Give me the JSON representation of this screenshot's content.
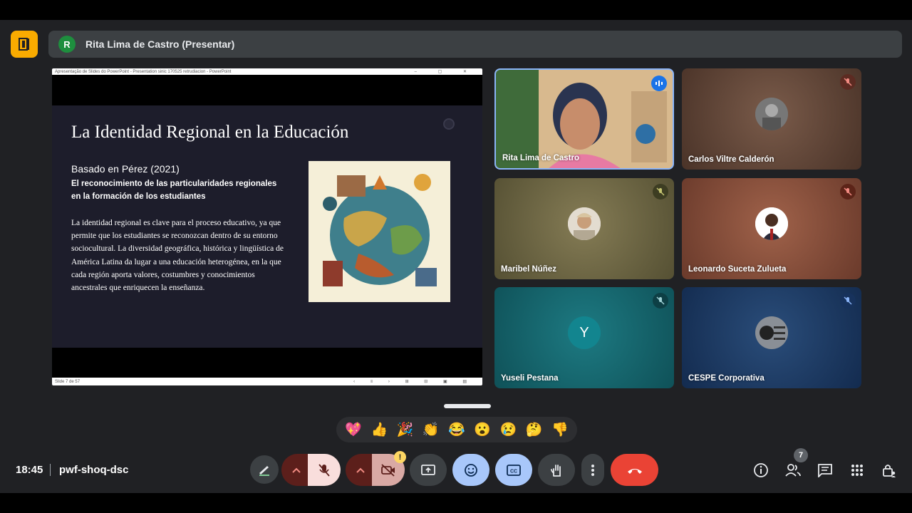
{
  "presenter_bar": {
    "avatar_letter": "R",
    "label": "Rita Lima de Castro (Presentar)"
  },
  "presentation": {
    "window_title": "Apresentação de Slides do PowerPoint  -  Presentation sinic 170525 retrudiacion  -  PowerPoint",
    "status_left": "Slide 7 de 57",
    "slide": {
      "title": "La Identidad Regional en la Educación",
      "subtitle": "Basado en Pérez (2021)",
      "bold_text": "El reconocimiento de las particularidades regionales en la formación de los estudiantes",
      "body": "La identidad regional es clave para el proceso educativo, ya que permite que los estudiantes se reconozcan dentro de su entorno sociocultural. La diversidad geográfica, histórica y lingüística de América Latina da lugar a una educación heterogénea, en la que cada región aporta valores, costumbres y conocimientos ancestrales que enriquecen la enseñanza."
    }
  },
  "participants": [
    {
      "name": "Rita Lima de Castro",
      "status": "speaking"
    },
    {
      "name": "Carlos Viltre Calderón",
      "status": "muted"
    },
    {
      "name": "Maribel Núñez",
      "status": "muted"
    },
    {
      "name": "Leonardo Suceta Zulueta",
      "status": "muted"
    },
    {
      "name": "Yuseli Pestana",
      "status": "muted",
      "avatar_letter": "Y"
    },
    {
      "name": "CESPE Corporativa",
      "status": "muted"
    }
  ],
  "reactions": [
    "💖",
    "👍",
    "🎉",
    "👏",
    "😂",
    "😮",
    "😢",
    "🤔",
    "👎"
  ],
  "footer": {
    "time": "18:45",
    "meeting_code": "pwf-shoq-dsc",
    "people_count": "7",
    "camera_warning": "!"
  },
  "colors": {
    "background": "#202124",
    "end_call": "#ea4335",
    "muted_red": "#f28b82",
    "active_blue": "#a8c7fa",
    "presenter_yellow": "#f9ab00"
  }
}
